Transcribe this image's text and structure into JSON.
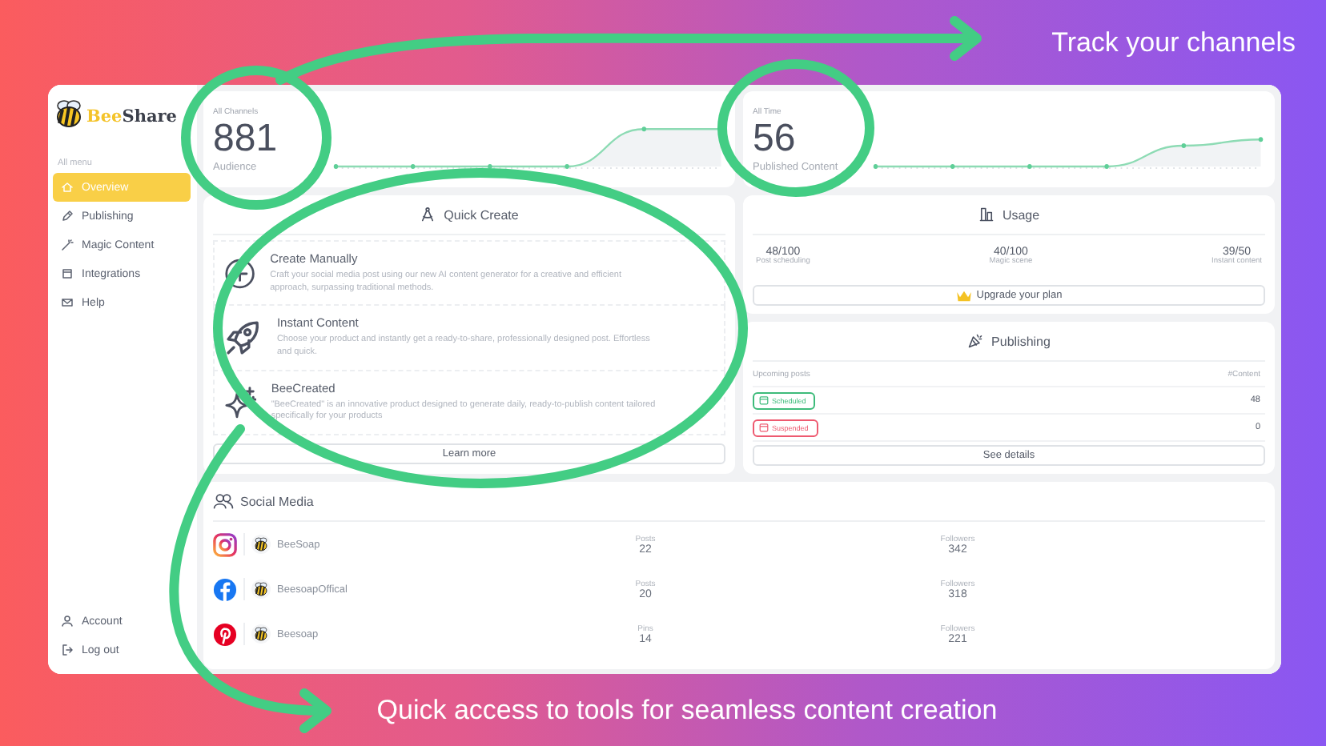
{
  "annotations": {
    "top": "Track your channels",
    "bottom": "Quick access to tools for seamless content creation"
  },
  "sidebar": {
    "brand": {
      "first": "Bee",
      "second": "Share"
    },
    "section": "All menu",
    "items": [
      {
        "label": "Overview",
        "kind": "home",
        "selected": true
      },
      {
        "label": "Publishing",
        "kind": "pen",
        "selected": false
      },
      {
        "label": "Magic Content",
        "kind": "wand",
        "selected": false
      },
      {
        "label": "Integrations",
        "kind": "box",
        "selected": false
      },
      {
        "label": "Help",
        "kind": "mail",
        "selected": false
      }
    ],
    "footer_items": [
      {
        "label": "Account",
        "kind": "user"
      },
      {
        "label": "Log out",
        "kind": "logout"
      }
    ]
  },
  "stats": [
    {
      "caption": "All Channels",
      "value": "881",
      "label": "Audience"
    },
    {
      "caption": "All Time",
      "value": "56",
      "label": "Published Content"
    }
  ],
  "quick_create": {
    "title": "Quick Create",
    "options": [
      {
        "kind": "plus",
        "title": "Create Manually",
        "description": "Craft your social media post using our new AI content generator for a creative and efficient approach, surpassing traditional methods."
      },
      {
        "kind": "rocket",
        "title": "Instant Content",
        "description": "Choose your product and instantly get a ready-to-share, professionally designed post. Effortless and quick."
      },
      {
        "kind": "sparkle",
        "title": "BeeCreated",
        "description": "\"BeeCreated\" is an innovative product designed to generate daily, ready-to-publish content tailored specifically for your products"
      }
    ],
    "button": "Learn more"
  },
  "usage": {
    "title": "Usage",
    "meters": [
      {
        "value": "48/100",
        "label": "Post scheduling"
      },
      {
        "value": "40/100",
        "label": "Magic scene"
      },
      {
        "value": "39/50",
        "label": "Instant content"
      }
    ],
    "button": "Upgrade your plan"
  },
  "publishing": {
    "title": "Publishing",
    "columns": [
      "Upcoming posts",
      "#Content"
    ],
    "rows": [
      {
        "status": "Scheduled",
        "color": "#3dbb7a",
        "count": "48"
      },
      {
        "status": "Suspended",
        "color": "#ee5a70",
        "count": "0"
      }
    ],
    "button": "See details"
  },
  "social": {
    "title": "Social Media",
    "accounts": [
      {
        "kind": "instagram",
        "name": "BeeSoap",
        "stats": [
          {
            "label": "Posts",
            "value": "22"
          },
          {
            "label": "Followers",
            "value": "342"
          }
        ]
      },
      {
        "kind": "facebook",
        "name": "BeesoapOffical",
        "stats": [
          {
            "label": "Posts",
            "value": "20"
          },
          {
            "label": "Followers",
            "value": "318"
          }
        ]
      },
      {
        "kind": "pinterest",
        "name": "Beesoap",
        "stats": [
          {
            "label": "Pins",
            "value": "14"
          },
          {
            "label": "Followers",
            "value": "221"
          }
        ]
      }
    ]
  }
}
